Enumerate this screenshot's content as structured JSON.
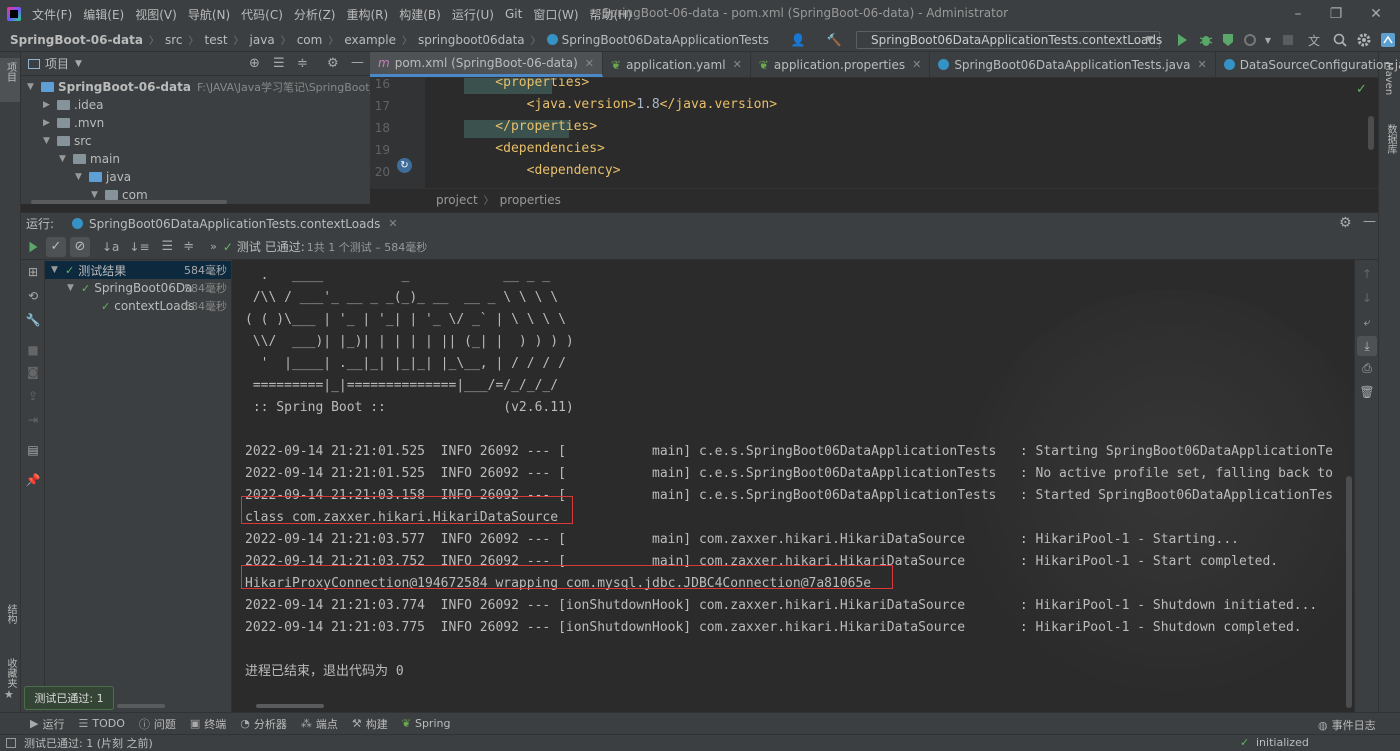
{
  "menu": [
    "文件(F)",
    "编辑(E)",
    "视图(V)",
    "导航(N)",
    "代码(C)",
    "分析(Z)",
    "重构(R)",
    "构建(B)",
    "运行(U)",
    "Git",
    "窗口(W)",
    "帮助(H)"
  ],
  "window_title": "SpringBoot-06-data - pom.xml (SpringBoot-06-data) - Administrator",
  "breadcrumbs": [
    "SpringBoot-06-data",
    "src",
    "test",
    "java",
    "com",
    "example",
    "springboot06data",
    "SpringBoot06DataApplicationTests"
  ],
  "run_config": "SpringBoot06DataApplicationTests.contextLoads",
  "left_stripe": {
    "project": "项目",
    "structure": "结构",
    "bookmarks": "收藏夹"
  },
  "right_stripe": {
    "maven": "Maven",
    "database": "数据库"
  },
  "project_panel": {
    "title": "项目",
    "root_name": "SpringBoot-06-data",
    "root_path": "F:\\JAVA\\Java学习笔记\\SpringBoot_狂",
    "items": [
      ".idea",
      ".mvn",
      "src",
      "main",
      "java",
      "com"
    ]
  },
  "editor_tabs": [
    {
      "label": "pom.xml (SpringBoot-06-data)",
      "icon": "m"
    },
    {
      "label": "application.yaml",
      "icon": "leaf"
    },
    {
      "label": "application.properties",
      "icon": "leaf"
    },
    {
      "label": "SpringBoot06DataApplicationTests.java",
      "icon": "c"
    },
    {
      "label": "DataSourceConfiguration.java",
      "icon": "c"
    }
  ],
  "editor": {
    "lines": [
      {
        "n": "16",
        "parts": [
          [
            "tag",
            "    <properties>"
          ]
        ]
      },
      {
        "n": "17",
        "parts": [
          [
            "tag",
            "        <java.version>"
          ],
          [
            "txt",
            "1.8"
          ],
          [
            "tag",
            "</java.version>"
          ]
        ]
      },
      {
        "n": "18",
        "parts": [
          [
            "tag",
            "    </properties>"
          ]
        ]
      },
      {
        "n": "19",
        "parts": [
          [
            "tag",
            "    <dependencies>"
          ]
        ]
      },
      {
        "n": "20",
        "parts": [
          [
            "tag",
            "        <dependency>"
          ]
        ]
      }
    ],
    "breadcrumb": [
      "project",
      "properties"
    ]
  },
  "run_panel": {
    "label": "运行:",
    "tab": "SpringBoot06DataApplicationTests.contextLoads",
    "status_prefix": "测试 已通过:",
    "status_count": "1共 1 个测试 – 584毫秒"
  },
  "test_tree": [
    {
      "label": "测试结果",
      "time": "584毫秒"
    },
    {
      "label": "SpringBoot06Da",
      "time": "584毫秒"
    },
    {
      "label": "contextLoads",
      "time": "584毫秒"
    }
  ],
  "console": {
    "banner": [
      "  .   ____          _            __ _ _",
      " /\\\\ / ___'_ __ _ _(_)_ __  __ _ \\ \\ \\ \\",
      "( ( )\\___ | '_ | '_| | '_ \\/ _` | \\ \\ \\ \\",
      " \\\\/  ___)| |_)| | | | | || (_| |  ) ) ) )",
      "  '  |____| .__|_| |_|_| |_\\__, | / / / /",
      " =========|_|==============|___/=/_/_/_/",
      " :: Spring Boot ::               (v2.6.11)"
    ],
    "logs": [
      "2022-09-14 21:21:01.525  INFO 26092 --- [           main] c.e.s.SpringBoot06DataApplicationTests   : Starting SpringBoot06DataApplicationTe",
      "2022-09-14 21:21:01.525  INFO 26092 --- [           main] c.e.s.SpringBoot06DataApplicationTests   : No active profile set, falling back to",
      "2022-09-14 21:21:03.158  INFO 26092 --- [           main] c.e.s.SpringBoot06DataApplicationTests   : Started SpringBoot06DataApplicationTes",
      "class com.zaxxer.hikari.HikariDataSource",
      "2022-09-14 21:21:03.577  INFO 26092 --- [           main] com.zaxxer.hikari.HikariDataSource       : HikariPool-1 - Starting...",
      "2022-09-14 21:21:03.752  INFO 26092 --- [           main] com.zaxxer.hikari.HikariDataSource       : HikariPool-1 - Start completed.",
      "HikariProxyConnection@194672584 wrapping com.mysql.jdbc.JDBC4Connection@7a81065e",
      "2022-09-14 21:21:03.774  INFO 26092 --- [ionShutdownHook] com.zaxxer.hikari.HikariDataSource       : HikariPool-1 - Shutdown initiated...",
      "2022-09-14 21:21:03.775  INFO 26092 --- [ionShutdownHook] com.zaxxer.hikari.HikariDataSource       : HikariPool-1 - Shutdown completed."
    ],
    "exit": "进程已结束，退出代码为 0",
    "highlight_color": "#d93838"
  },
  "tooltip": "测试已通过: 1",
  "bottom_tools": [
    "运行",
    "TODO",
    "问题",
    "终端",
    "分析器",
    "端点",
    "构建",
    "Spring"
  ],
  "event_log": "事件日志",
  "statusbar": {
    "left": "测试已通过: 1 (片刻 之前)",
    "right": "initialized"
  },
  "colors": {
    "accent": "#4a88c7",
    "success": "#5fb85f",
    "xml_tag": "#e8bf6a"
  }
}
